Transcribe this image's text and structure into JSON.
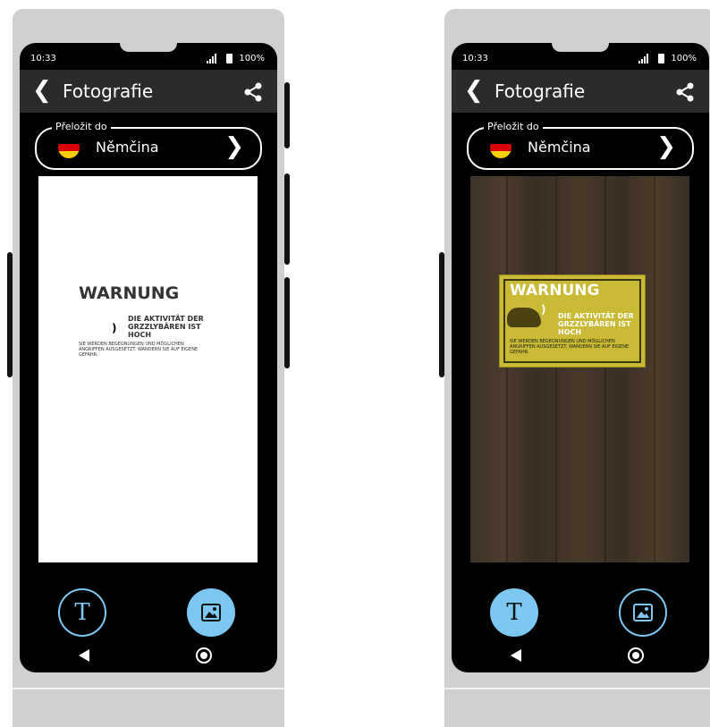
{
  "status": {
    "time": "10:33",
    "battery": "100%"
  },
  "appbar": {
    "title": "Fotografie"
  },
  "language": {
    "label": "Přeložit do",
    "name": "Němčina"
  },
  "sign_text": {
    "title": "WARNUNG",
    "subtitle_line1": "DIE AKTIVITÄT DER",
    "subtitle_line2": "GRZZLYBÄREN IST",
    "subtitle_line3": "HOCH",
    "paren": ")",
    "body_line1": "SIE WERDEN BEGEGNUNGEN UND MÖGLICHEN",
    "body_line2": "ANGRIFFEN AUSGESETZT. WANDERN SIE AUF EIGENE",
    "body_line3": "GEFAHR."
  },
  "colors": {
    "accent": "#7cc8f2",
    "appbar": "#2b2b2b",
    "background": "#000000"
  },
  "icons": {
    "back": "chevron-left-icon",
    "share": "share-icon",
    "text_mode": "text-icon",
    "image_mode": "image-icon"
  }
}
